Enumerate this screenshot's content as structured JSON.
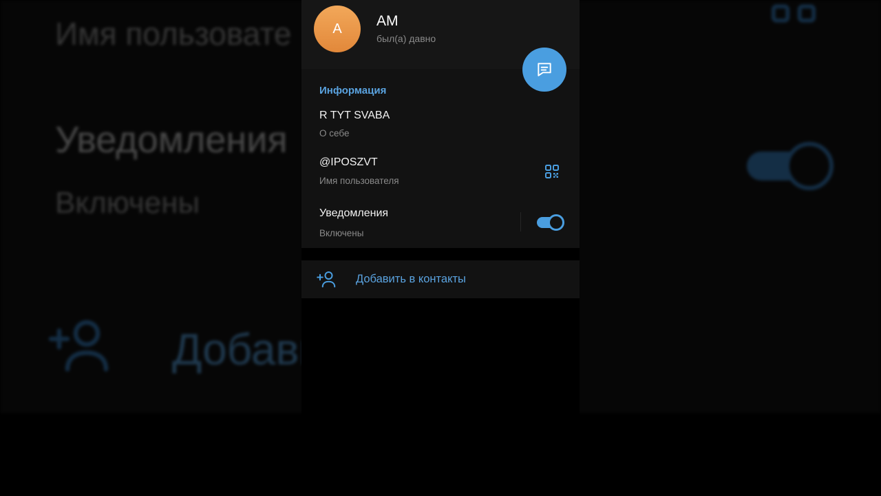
{
  "background": {
    "username_label": "Имя пользовате",
    "notifications_title": "Уведомления",
    "notifications_state": "Включены",
    "add_contact_partial": "Добави"
  },
  "profile": {
    "avatar_letter": "A",
    "name": "AM",
    "last_seen": "был(а) давно"
  },
  "info": {
    "section_title": "Информация",
    "bio_value": "R TYT SVABA",
    "bio_label": "О себе",
    "username_value": "@IPOSZVT",
    "username_label": "Имя пользователя",
    "notifications_value": "Уведомления",
    "notifications_label": "Включены",
    "notifications_enabled": true
  },
  "actions": {
    "add_contact": "Добавить в контакты"
  },
  "icons": {
    "fab": "message-icon",
    "qr": "qr-code-icon",
    "add": "add-contact-icon"
  },
  "colors": {
    "accent": "#4a9ee0",
    "avatar": "#e99a4c",
    "background": "#000000",
    "surface": "#121212"
  }
}
